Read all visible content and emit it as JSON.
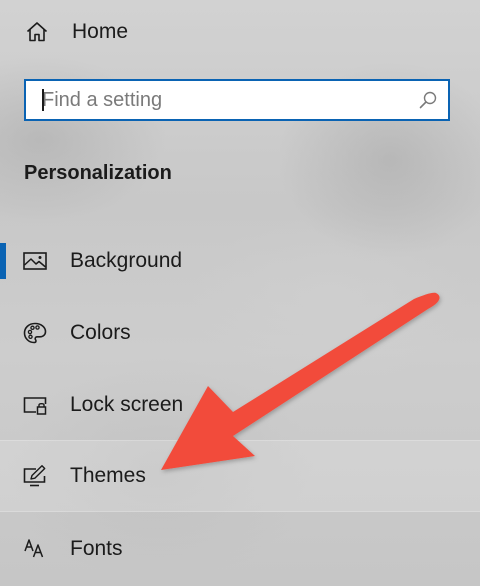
{
  "home": {
    "label": "Home",
    "icon": "home-icon"
  },
  "search": {
    "placeholder": "Find a setting",
    "value": "",
    "icon": "search-icon",
    "focus_color": "#0a63b3"
  },
  "section": {
    "title": "Personalization"
  },
  "nav": {
    "items": [
      {
        "label": "Background",
        "icon": "picture-icon",
        "selected": true
      },
      {
        "label": "Colors",
        "icon": "palette-icon",
        "selected": false
      },
      {
        "label": "Lock screen",
        "icon": "lock-screen-icon",
        "selected": false
      },
      {
        "label": "Themes",
        "icon": "themes-icon",
        "selected": false,
        "hovered": true
      },
      {
        "label": "Fonts",
        "icon": "fonts-icon",
        "selected": false
      }
    ]
  },
  "annotation": {
    "type": "arrow",
    "color": "#f24b3b",
    "points_to": "Themes"
  },
  "colors": {
    "accent": "#0a63b3",
    "text": "#1b1b1b",
    "annotation": "#f24b3b"
  }
}
